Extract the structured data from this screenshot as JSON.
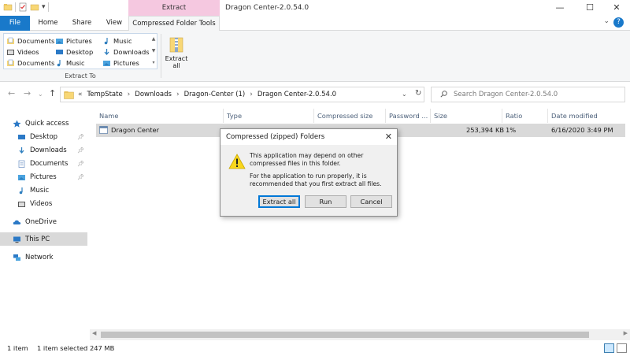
{
  "titlebar": {
    "title": "Dragon Center-2.0.54.0",
    "context_tab_group": "Extract",
    "minimize": "—",
    "maximize": "☐",
    "close": "✕"
  },
  "ribbon_tabs": {
    "file": "File",
    "home": "Home",
    "share": "Share",
    "view": "View",
    "compressed_folder_tools": "Compressed Folder Tools"
  },
  "ribbon": {
    "extract_to_items": [
      "Documents",
      "Pictures",
      "Music",
      "Videos",
      "Desktop",
      "Downloads",
      "Documents",
      "Music",
      "Pictures"
    ],
    "extract_to_label": "Extract To",
    "extract_all_line1": "Extract",
    "extract_all_line2": "all"
  },
  "address": {
    "crumbs": [
      "TempState",
      "Downloads",
      "Dragon-Center (1)",
      "Dragon Center-2.0.54.0"
    ],
    "prefix": "«",
    "search_placeholder": "Search Dragon Center-2.0.54.0"
  },
  "nav": {
    "quick_access": "Quick access",
    "items": [
      "Desktop",
      "Downloads",
      "Documents",
      "Pictures",
      "Music",
      "Videos"
    ],
    "onedrive": "OneDrive",
    "this_pc": "This PC",
    "network": "Network"
  },
  "columns": [
    "Name",
    "Type",
    "Compressed size",
    "Password ...",
    "Size",
    "Ratio",
    "Date modified"
  ],
  "rows": [
    {
      "name": "Dragon Center",
      "size": "253,394 KB",
      "ratio": "1%",
      "date": "6/16/2020 3:49 PM"
    }
  ],
  "status": {
    "count": "1 item",
    "selected": "1 item selected  247 MB"
  },
  "dialog": {
    "title": "Compressed (zipped) Folders",
    "message1": "This application may depend on other compressed files in this folder.",
    "message2": "For the application to run properly, it is recommended that you first extract all files.",
    "extract_all": "Extract all",
    "run": "Run",
    "cancel": "Cancel"
  },
  "colors": {
    "accent": "#1979ca",
    "context_tab": "#f5c8e0",
    "selection": "#d9d9d9",
    "folder": "#f8d775"
  }
}
